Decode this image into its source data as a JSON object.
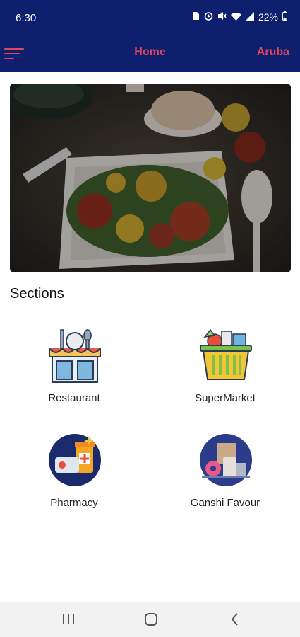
{
  "status_bar": {
    "time": "6:30",
    "battery": "22%",
    "icons": [
      "sim-icon",
      "alarm-icon",
      "mute-icon",
      "wifi-icon",
      "signal-icon",
      "battery-icon"
    ]
  },
  "app_bar": {
    "title": "Home",
    "location": "Aruba",
    "menu_icon": "hamburger-menu-icon"
  },
  "banner": {
    "image": "food-dish-photo"
  },
  "sections": {
    "title": "Sections",
    "items": [
      {
        "label": "Restaurant",
        "icon": "restaurant-icon"
      },
      {
        "label": "SuperMarket",
        "icon": "supermarket-basket-icon"
      },
      {
        "label": "Pharmacy",
        "icon": "pharmacy-icon"
      },
      {
        "label": "Ganshi Favour",
        "icon": "ganshi-favour-icon"
      }
    ]
  },
  "system_nav": {
    "icons": [
      "recents-icon",
      "home-icon",
      "back-icon"
    ]
  },
  "colors": {
    "primary": "#0d1f6d",
    "accent": "#e0455f",
    "navbar": "#f2f2f2"
  }
}
